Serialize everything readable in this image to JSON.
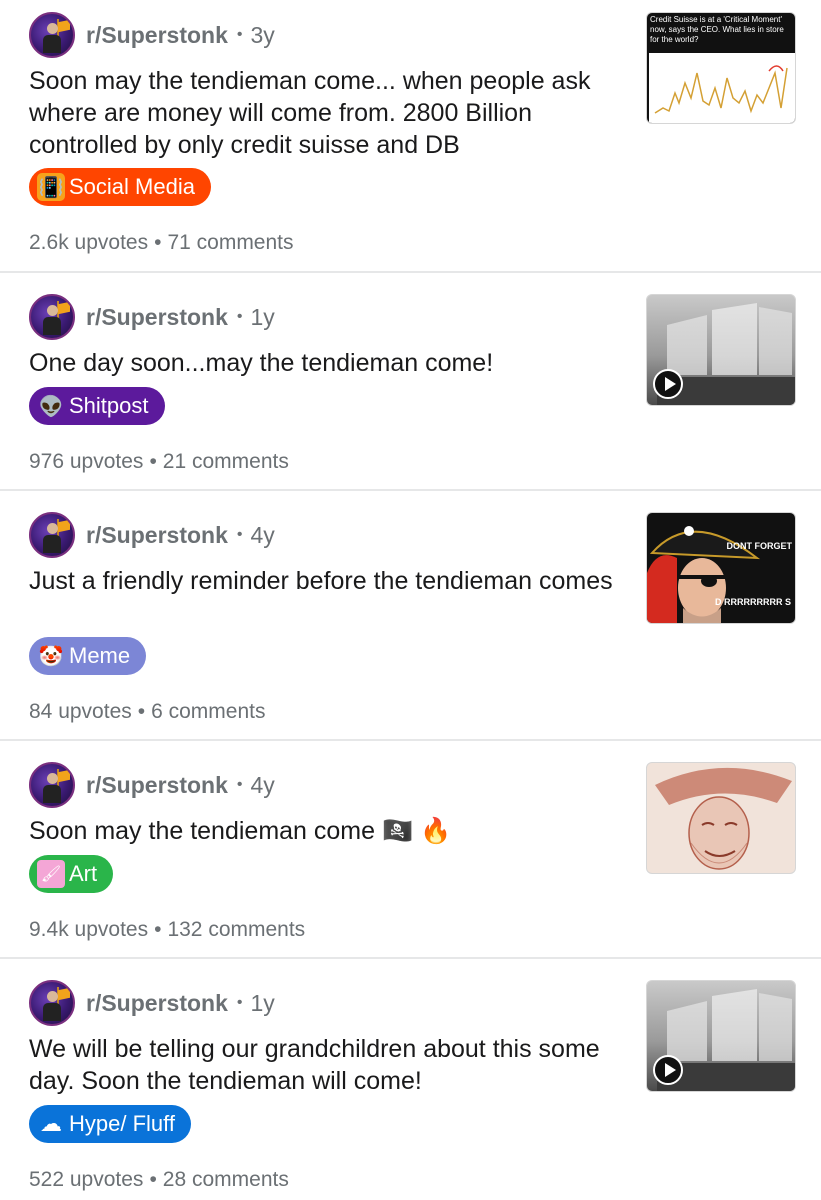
{
  "posts": [
    {
      "subreddit": "r/Superstonk",
      "age": "3y",
      "title": "Soon may the tendieman come... when people ask where are money will come from. 2800 Billion controlled by only credit suisse and DB",
      "flair": {
        "label": "Social Media",
        "icon": "phone-vibrate-icon",
        "glyph": "📳",
        "color": "#ff4500"
      },
      "upvotes": "2.6k upvotes",
      "comments": "71 comments",
      "thumbnail": {
        "kind": "chart-screenshot",
        "caption": "Credit Suisse is at a 'Critical Moment' now, says the CEO. What lies in store for the world?"
      }
    },
    {
      "subreddit": "r/Superstonk",
      "age": "1y",
      "title": "One day soon...may the tendieman come!",
      "flair": {
        "label": "Shitpost",
        "icon": "alien-icon",
        "glyph": "👽",
        "color": "#5c1a9c"
      },
      "upvotes": "976 upvotes",
      "comments": "21 comments",
      "thumbnail": {
        "kind": "video-ship"
      }
    },
    {
      "subreddit": "r/Superstonk",
      "age": "4y",
      "title": "Just a friendly reminder before the tendieman comes",
      "flair": {
        "label": "Meme",
        "icon": "clown-face-icon",
        "glyph": "🤡",
        "color": "#7c86d6"
      },
      "upvotes": "84 upvotes",
      "comments": "6 comments",
      "thumbnail": {
        "kind": "pirate-meme",
        "caption_top": "DONT FORGET",
        "caption_bottom": "D RRRRRRRRR S"
      }
    },
    {
      "subreddit": "r/Superstonk",
      "age": "4y",
      "title": "Soon may the tendieman come 🏴‍☠️ 🔥",
      "flair": {
        "label": "Art",
        "icon": "paintbrush-icon",
        "glyph": "🖌",
        "color": "#2ab54a"
      },
      "upvotes": "9.4k upvotes",
      "comments": "132 comments",
      "thumbnail": {
        "kind": "pirate-sketch"
      }
    },
    {
      "subreddit": "r/Superstonk",
      "age": "1y",
      "title": "We will be telling our grandchildren about this some day. Soon the tendieman will come!",
      "flair": {
        "label": "Hype/ Fluff",
        "icon": "cloud-icon",
        "glyph": "☁",
        "color": "#0a73d9"
      },
      "upvotes": "522 upvotes",
      "comments": "28 comments",
      "thumbnail": {
        "kind": "video-ship"
      }
    }
  ]
}
